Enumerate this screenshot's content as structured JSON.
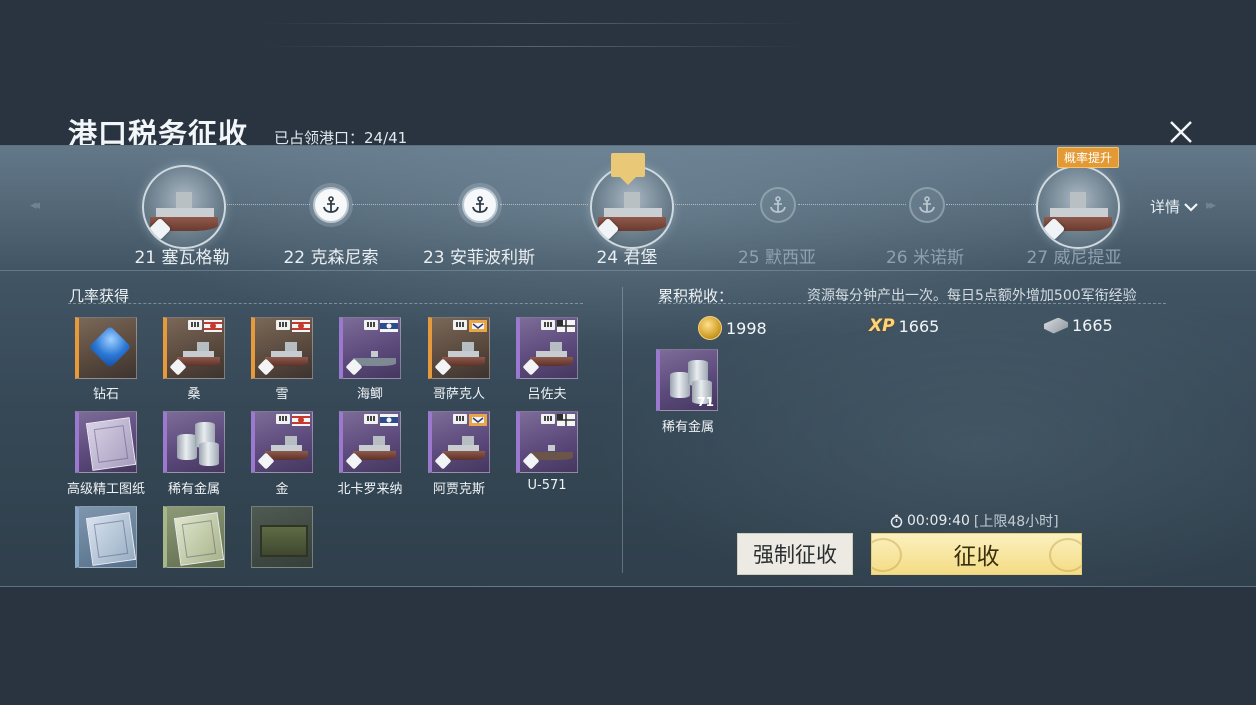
{
  "header": {
    "title": "港口税务征收",
    "occupied_label": "已占领港口：24/41"
  },
  "track": {
    "nodes": [
      {
        "label": "21 塞瓦格勒",
        "type": "ship",
        "active": true
      },
      {
        "label": "22 克森尼索",
        "type": "anchor",
        "active": true
      },
      {
        "label": "23 安菲波利斯",
        "type": "anchor",
        "active": true
      },
      {
        "label": "24 君堡",
        "type": "ship",
        "active": true,
        "current": true
      },
      {
        "label": "25 默西亚",
        "type": "anchor",
        "active": false
      },
      {
        "label": "26 米诺斯",
        "type": "anchor",
        "active": false
      },
      {
        "label": "27 威尼提亚",
        "type": "ship",
        "active": false
      }
    ],
    "rate_badge": "概率提升",
    "details_label": "详情"
  },
  "probability": {
    "title": "几率获得",
    "items": [
      {
        "label": "钻石",
        "kind": "diamond",
        "rarity": "orange"
      },
      {
        "label": "桑",
        "kind": "ship",
        "rarity": "orange"
      },
      {
        "label": "雪",
        "kind": "ship",
        "rarity": "orange"
      },
      {
        "label": "海鲫",
        "kind": "ship",
        "rarity": "purple"
      },
      {
        "label": "哥萨克人",
        "kind": "ship",
        "rarity": "orange"
      },
      {
        "label": "吕佐夫",
        "kind": "ship",
        "rarity": "purple"
      },
      {
        "label": "高级精工图纸",
        "kind": "blueprint",
        "rarity": "purple"
      },
      {
        "label": "稀有金属",
        "kind": "metal",
        "rarity": "purple"
      },
      {
        "label": "金",
        "kind": "ship",
        "rarity": "purple"
      },
      {
        "label": "北卡罗来纳",
        "kind": "ship",
        "rarity": "purple"
      },
      {
        "label": "阿贾克斯",
        "kind": "ship",
        "rarity": "purple"
      },
      {
        "label": "U-571",
        "kind": "ship",
        "rarity": "purple"
      },
      {
        "label": "",
        "kind": "blueprint",
        "rarity": "blue"
      },
      {
        "label": "",
        "kind": "blueprint",
        "rarity": "green"
      },
      {
        "label": "",
        "kind": "crate",
        "rarity": "none"
      }
    ]
  },
  "accumulated": {
    "title": "累积税收：",
    "description": "资源每分钟产出一次。每日5点额外增加500军衔经验",
    "resources": [
      {
        "icon": "gold-coin-icon",
        "value": "1998"
      },
      {
        "icon": "xp-icon",
        "symbol": "XP",
        "value": "1665"
      },
      {
        "icon": "steel-icon",
        "value": "1665"
      }
    ],
    "item": {
      "label": "稀有金属",
      "count": "71"
    }
  },
  "timer": {
    "value": "00:09:40",
    "limit": "[上限48小时]"
  },
  "buttons": {
    "force_collect": "强制征收",
    "collect": "征收"
  },
  "colors": {
    "collect_button": "#f4dc86",
    "rate_badge": "#e39a35",
    "rarity_orange": "#e69a3b",
    "rarity_purple": "#9a79cf"
  }
}
